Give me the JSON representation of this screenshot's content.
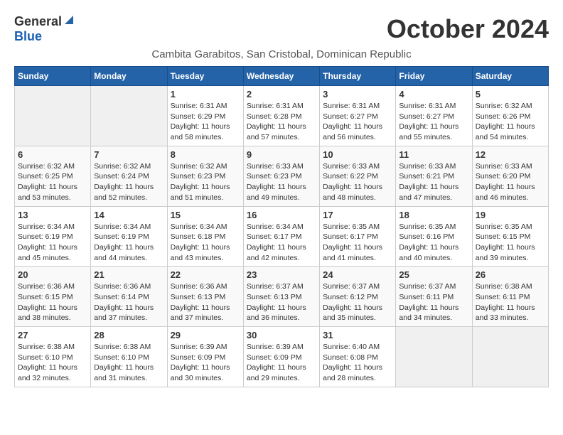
{
  "logo": {
    "general": "General",
    "blue": "Blue"
  },
  "title": "October 2024",
  "subtitle": "Cambita Garabitos, San Cristobal, Dominican Republic",
  "headers": [
    "Sunday",
    "Monday",
    "Tuesday",
    "Wednesday",
    "Thursday",
    "Friday",
    "Saturday"
  ],
  "weeks": [
    [
      {
        "day": "",
        "info": ""
      },
      {
        "day": "",
        "info": ""
      },
      {
        "day": "1",
        "sunrise": "Sunrise: 6:31 AM",
        "sunset": "Sunset: 6:29 PM",
        "daylight": "Daylight: 11 hours and 58 minutes."
      },
      {
        "day": "2",
        "sunrise": "Sunrise: 6:31 AM",
        "sunset": "Sunset: 6:28 PM",
        "daylight": "Daylight: 11 hours and 57 minutes."
      },
      {
        "day": "3",
        "sunrise": "Sunrise: 6:31 AM",
        "sunset": "Sunset: 6:27 PM",
        "daylight": "Daylight: 11 hours and 56 minutes."
      },
      {
        "day": "4",
        "sunrise": "Sunrise: 6:31 AM",
        "sunset": "Sunset: 6:27 PM",
        "daylight": "Daylight: 11 hours and 55 minutes."
      },
      {
        "day": "5",
        "sunrise": "Sunrise: 6:32 AM",
        "sunset": "Sunset: 6:26 PM",
        "daylight": "Daylight: 11 hours and 54 minutes."
      }
    ],
    [
      {
        "day": "6",
        "sunrise": "Sunrise: 6:32 AM",
        "sunset": "Sunset: 6:25 PM",
        "daylight": "Daylight: 11 hours and 53 minutes."
      },
      {
        "day": "7",
        "sunrise": "Sunrise: 6:32 AM",
        "sunset": "Sunset: 6:24 PM",
        "daylight": "Daylight: 11 hours and 52 minutes."
      },
      {
        "day": "8",
        "sunrise": "Sunrise: 6:32 AM",
        "sunset": "Sunset: 6:23 PM",
        "daylight": "Daylight: 11 hours and 51 minutes."
      },
      {
        "day": "9",
        "sunrise": "Sunrise: 6:33 AM",
        "sunset": "Sunset: 6:23 PM",
        "daylight": "Daylight: 11 hours and 49 minutes."
      },
      {
        "day": "10",
        "sunrise": "Sunrise: 6:33 AM",
        "sunset": "Sunset: 6:22 PM",
        "daylight": "Daylight: 11 hours and 48 minutes."
      },
      {
        "day": "11",
        "sunrise": "Sunrise: 6:33 AM",
        "sunset": "Sunset: 6:21 PM",
        "daylight": "Daylight: 11 hours and 47 minutes."
      },
      {
        "day": "12",
        "sunrise": "Sunrise: 6:33 AM",
        "sunset": "Sunset: 6:20 PM",
        "daylight": "Daylight: 11 hours and 46 minutes."
      }
    ],
    [
      {
        "day": "13",
        "sunrise": "Sunrise: 6:34 AM",
        "sunset": "Sunset: 6:19 PM",
        "daylight": "Daylight: 11 hours and 45 minutes."
      },
      {
        "day": "14",
        "sunrise": "Sunrise: 6:34 AM",
        "sunset": "Sunset: 6:19 PM",
        "daylight": "Daylight: 11 hours and 44 minutes."
      },
      {
        "day": "15",
        "sunrise": "Sunrise: 6:34 AM",
        "sunset": "Sunset: 6:18 PM",
        "daylight": "Daylight: 11 hours and 43 minutes."
      },
      {
        "day": "16",
        "sunrise": "Sunrise: 6:34 AM",
        "sunset": "Sunset: 6:17 PM",
        "daylight": "Daylight: 11 hours and 42 minutes."
      },
      {
        "day": "17",
        "sunrise": "Sunrise: 6:35 AM",
        "sunset": "Sunset: 6:17 PM",
        "daylight": "Daylight: 11 hours and 41 minutes."
      },
      {
        "day": "18",
        "sunrise": "Sunrise: 6:35 AM",
        "sunset": "Sunset: 6:16 PM",
        "daylight": "Daylight: 11 hours and 40 minutes."
      },
      {
        "day": "19",
        "sunrise": "Sunrise: 6:35 AM",
        "sunset": "Sunset: 6:15 PM",
        "daylight": "Daylight: 11 hours and 39 minutes."
      }
    ],
    [
      {
        "day": "20",
        "sunrise": "Sunrise: 6:36 AM",
        "sunset": "Sunset: 6:15 PM",
        "daylight": "Daylight: 11 hours and 38 minutes."
      },
      {
        "day": "21",
        "sunrise": "Sunrise: 6:36 AM",
        "sunset": "Sunset: 6:14 PM",
        "daylight": "Daylight: 11 hours and 37 minutes."
      },
      {
        "day": "22",
        "sunrise": "Sunrise: 6:36 AM",
        "sunset": "Sunset: 6:13 PM",
        "daylight": "Daylight: 11 hours and 37 minutes."
      },
      {
        "day": "23",
        "sunrise": "Sunrise: 6:37 AM",
        "sunset": "Sunset: 6:13 PM",
        "daylight": "Daylight: 11 hours and 36 minutes."
      },
      {
        "day": "24",
        "sunrise": "Sunrise: 6:37 AM",
        "sunset": "Sunset: 6:12 PM",
        "daylight": "Daylight: 11 hours and 35 minutes."
      },
      {
        "day": "25",
        "sunrise": "Sunrise: 6:37 AM",
        "sunset": "Sunset: 6:11 PM",
        "daylight": "Daylight: 11 hours and 34 minutes."
      },
      {
        "day": "26",
        "sunrise": "Sunrise: 6:38 AM",
        "sunset": "Sunset: 6:11 PM",
        "daylight": "Daylight: 11 hours and 33 minutes."
      }
    ],
    [
      {
        "day": "27",
        "sunrise": "Sunrise: 6:38 AM",
        "sunset": "Sunset: 6:10 PM",
        "daylight": "Daylight: 11 hours and 32 minutes."
      },
      {
        "day": "28",
        "sunrise": "Sunrise: 6:38 AM",
        "sunset": "Sunset: 6:10 PM",
        "daylight": "Daylight: 11 hours and 31 minutes."
      },
      {
        "day": "29",
        "sunrise": "Sunrise: 6:39 AM",
        "sunset": "Sunset: 6:09 PM",
        "daylight": "Daylight: 11 hours and 30 minutes."
      },
      {
        "day": "30",
        "sunrise": "Sunrise: 6:39 AM",
        "sunset": "Sunset: 6:09 PM",
        "daylight": "Daylight: 11 hours and 29 minutes."
      },
      {
        "day": "31",
        "sunrise": "Sunrise: 6:40 AM",
        "sunset": "Sunset: 6:08 PM",
        "daylight": "Daylight: 11 hours and 28 minutes."
      },
      {
        "day": "",
        "info": ""
      },
      {
        "day": "",
        "info": ""
      }
    ]
  ]
}
